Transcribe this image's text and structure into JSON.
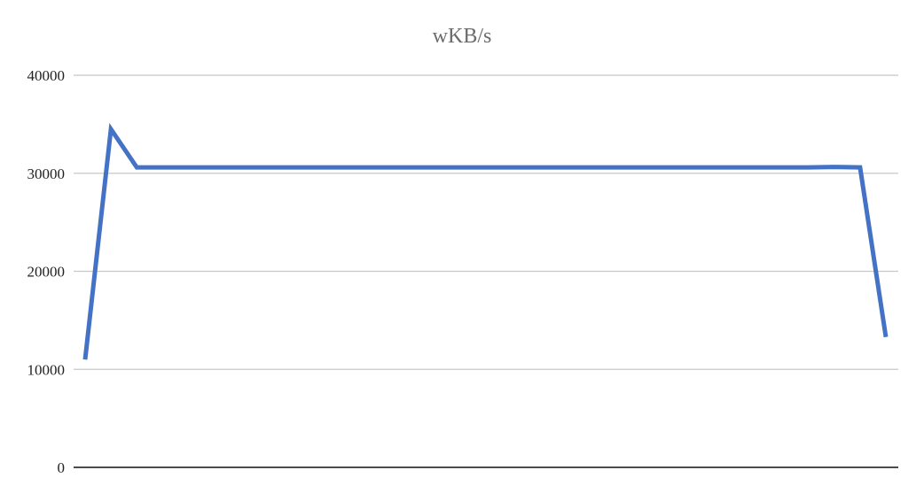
{
  "chart_data": {
    "type": "line",
    "title": "wKB/s",
    "xlabel": "",
    "ylabel": "",
    "ylim": [
      0,
      40000
    ],
    "yticks": [
      "0",
      "10000",
      "20000",
      "30000",
      "40000"
    ],
    "grid": true,
    "series": [
      {
        "color": "#4472c4",
        "values": [
          11000,
          34500,
          30600,
          30600,
          30600,
          30600,
          30600,
          30600,
          30600,
          30600,
          30600,
          30600,
          30600,
          30600,
          30600,
          30600,
          30600,
          30600,
          30600,
          30600,
          30600,
          30600,
          30600,
          30600,
          30600,
          30600,
          30600,
          30600,
          30600,
          30650,
          30600,
          13300
        ]
      }
    ]
  }
}
